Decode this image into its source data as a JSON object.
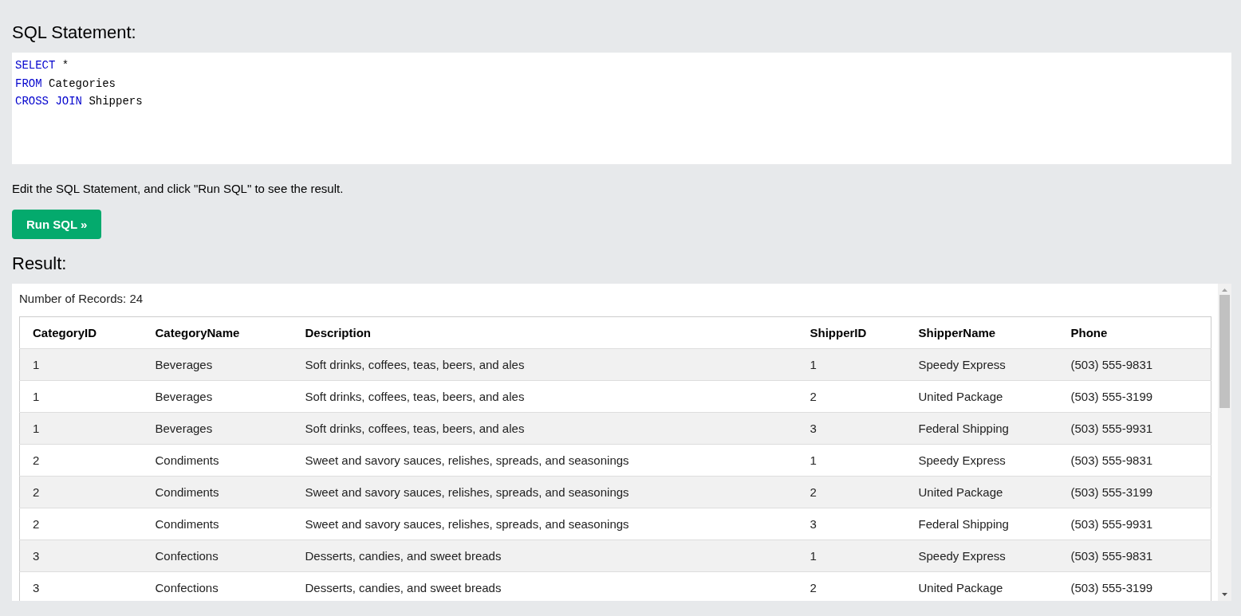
{
  "editor": {
    "heading": "SQL Statement:",
    "lines": [
      [
        {
          "kind": "keyword",
          "text": "SELECT"
        },
        {
          "kind": "plain",
          "text": " *"
        }
      ],
      [
        {
          "kind": "keyword",
          "text": "FROM"
        },
        {
          "kind": "plain",
          "text": " Categories"
        }
      ],
      [
        {
          "kind": "keyword",
          "text": "CROSS JOIN"
        },
        {
          "kind": "plain",
          "text": " Shippers"
        }
      ]
    ]
  },
  "hint": "Edit the SQL Statement, and click \"Run SQL\" to see the result.",
  "run_button": "Run SQL »",
  "result": {
    "heading": "Result:",
    "record_count": "Number of Records: 24",
    "table": {
      "columns": [
        "CategoryID",
        "CategoryName",
        "Description",
        "ShipperID",
        "ShipperName",
        "Phone"
      ],
      "rows": [
        [
          "1",
          "Beverages",
          "Soft drinks, coffees, teas, beers, and ales",
          "1",
          "Speedy Express",
          "(503) 555-9831"
        ],
        [
          "1",
          "Beverages",
          "Soft drinks, coffees, teas, beers, and ales",
          "2",
          "United Package",
          "(503) 555-3199"
        ],
        [
          "1",
          "Beverages",
          "Soft drinks, coffees, teas, beers, and ales",
          "3",
          "Federal Shipping",
          "(503) 555-9931"
        ],
        [
          "2",
          "Condiments",
          "Sweet and savory sauces, relishes, spreads, and seasonings",
          "1",
          "Speedy Express",
          "(503) 555-9831"
        ],
        [
          "2",
          "Condiments",
          "Sweet and savory sauces, relishes, spreads, and seasonings",
          "2",
          "United Package",
          "(503) 555-3199"
        ],
        [
          "2",
          "Condiments",
          "Sweet and savory sauces, relishes, spreads, and seasonings",
          "3",
          "Federal Shipping",
          "(503) 555-9931"
        ],
        [
          "3",
          "Confections",
          "Desserts, candies, and sweet breads",
          "1",
          "Speedy Express",
          "(503) 555-9831"
        ],
        [
          "3",
          "Confections",
          "Desserts, candies, and sweet breads",
          "2",
          "United Package",
          "(503) 555-3199"
        ]
      ]
    }
  }
}
